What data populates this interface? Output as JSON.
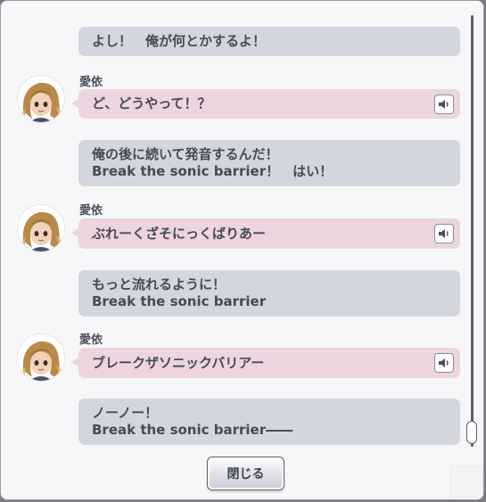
{
  "speaker_name": "愛依",
  "messages": [
    {
      "type": "narration",
      "lines": [
        "よし！　俺が何とかするよ！"
      ]
    },
    {
      "type": "character",
      "lines": [
        "ど、どうやって！？"
      ]
    },
    {
      "type": "narration",
      "lines": [
        "俺の後に続いて発音するんだ！",
        "Break the sonic barrier！　はい！"
      ]
    },
    {
      "type": "character",
      "lines": [
        "ぶれーくざそにっくばりあー"
      ]
    },
    {
      "type": "narration",
      "lines": [
        "もっと流れるように！",
        "Break the sonic barrier"
      ]
    },
    {
      "type": "character",
      "lines": [
        "ブレークザソニックバリアー"
      ]
    },
    {
      "type": "narration",
      "lines": [
        "ノーノー！",
        "Break the sonic barrier――"
      ]
    }
  ],
  "close_button": {
    "label": "閉じる"
  },
  "icons": {
    "voice": "speaker-icon",
    "avatar": "character-avatar"
  },
  "colors": {
    "narration_bg": "#d3d6de",
    "character_bg": "#ecd5df",
    "text": "#454a58"
  }
}
